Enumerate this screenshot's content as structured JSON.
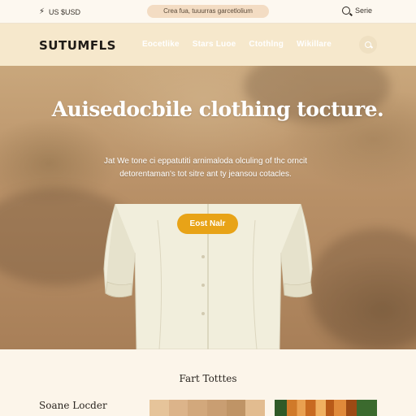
{
  "utility_bar": {
    "left_text": "US $USD",
    "promo_text": "Crea fua, tuuurras garcetlolium",
    "right_text": "Serie"
  },
  "nav": {
    "logo": "SUTUMFLS",
    "links": [
      "Eocetlike",
      "Stars Luoe",
      "Ctothlng",
      "Wikillare"
    ]
  },
  "hero": {
    "title": "Auisedocbile clothing tocture.",
    "subtitle": "Jat We tone ci eppatutiti arnimaloda olculing of thc orncit detorentaman's tot sitre ant ty jeansou cotacles.",
    "cta_label": "Eost Nalr"
  },
  "bottom": {
    "section_title": "Fart Totttes",
    "sub_title": "Soane Locder"
  },
  "colors": {
    "accent": "#e8a317",
    "nav_bg": "#f6e8cc",
    "promo_bg": "#f3dcc3",
    "swatches": [
      "#e6c49a",
      "#dcb48a",
      "#d2a87c",
      "#c99e72",
      "#bf9466",
      "#e2bc90"
    ]
  },
  "icons": {
    "bolt": "bolt-icon",
    "search": "search-icon",
    "hanger": "hanger-icon"
  }
}
